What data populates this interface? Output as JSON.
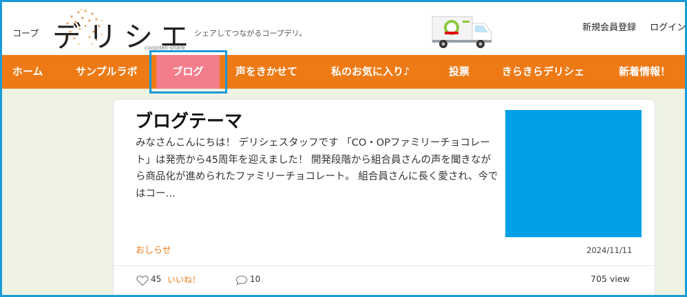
{
  "header": {
    "logo_prefix": "コープ",
    "logo_main": "デリシエ",
    "logo_sub": "coopdeli-share",
    "tagline": "シェアしてつながるコープデリ。",
    "truck_icon": "delivery-truck-icon",
    "links": [
      "新規会員登録",
      "ログイン"
    ]
  },
  "nav": {
    "items": [
      {
        "label": "ホーム"
      },
      {
        "label": "サンプルラボ"
      },
      {
        "label": "ブログ"
      },
      {
        "label": "声をきかせて"
      },
      {
        "label": "私のお気に入り♪"
      },
      {
        "label": "投票"
      },
      {
        "label": "きらきらデリシェ"
      },
      {
        "label": "新着情報！"
      }
    ],
    "active_index": 2
  },
  "post": {
    "title": "ブログテーマ",
    "excerpt": "みなさんこんにちは！ デリシェスタッフです 「CO・OPファミリーチョコレート」は発売から45周年を迎えました！ 開発段階から組合員さんの声を聞きながら商品化が進められたファミリーチョコレート。 組合員さんに長く愛され、今ではコー…",
    "category": "おしらせ",
    "date": "2024/11/11",
    "likes": "45",
    "like_label": "いいね！",
    "comments": "10",
    "views": "705 view"
  },
  "colors": {
    "nav_bg": "#ee7a16",
    "nav_active": "#f37d8b",
    "highlight": "#1a9ad6",
    "thumb": "#00a1e6",
    "page_bg": "#eef3e4",
    "accent_text": "#ee7a16"
  }
}
